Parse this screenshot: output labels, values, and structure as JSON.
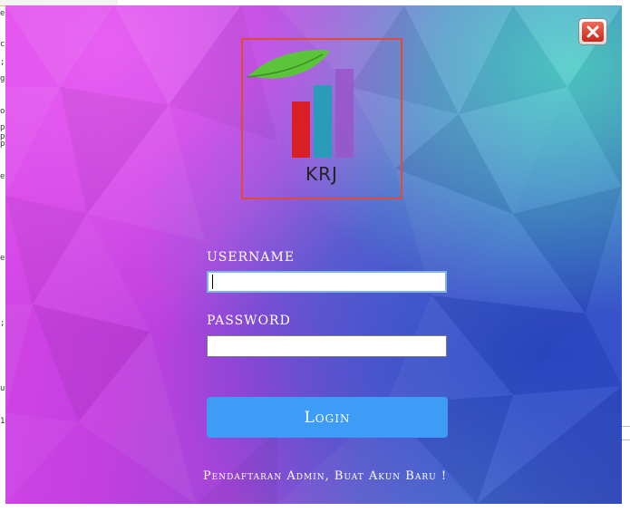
{
  "background_fragments": [
    "e",
    "c",
    ";",
    "g",
    "o",
    "p",
    "p",
    "p",
    "e",
    "e",
    ";",
    "u",
    "1"
  ],
  "login_window": {
    "logo": {
      "text": "KRJ",
      "icon": "leaf-bar-chart-logo"
    },
    "username": {
      "label": "USERNAME",
      "value": ""
    },
    "password": {
      "label": "PASSWORD",
      "value": ""
    },
    "login_button": "Login",
    "register_link": "Pendaftaran Admin, Buat Akun Baru !",
    "close_icon": "close-icon"
  },
  "colors": {
    "logo_border": "#e04a3a",
    "button": "#3d9cf5",
    "bar_red": "#d81f26",
    "bar_teal": "#2a9bb8",
    "bar_purple": "#9a55c8",
    "leaf": "#5cc43a"
  }
}
